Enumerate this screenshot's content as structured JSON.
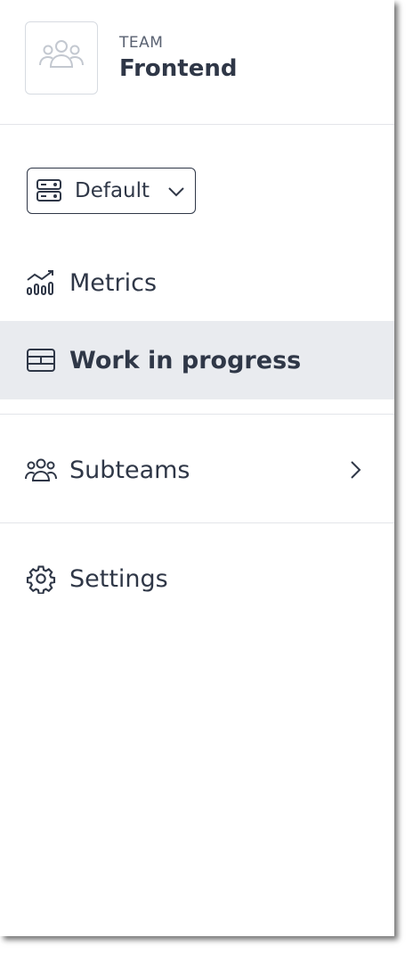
{
  "team": {
    "kicker": "TEAM",
    "name": "Frontend",
    "avatar_icon": "team-group-icon"
  },
  "view_selector": {
    "label": "Default",
    "icon": "server-stack-icon",
    "chevron": "chevron-down-icon"
  },
  "nav": {
    "metrics": {
      "label": "Metrics",
      "icon": "chart-bars-line-icon"
    },
    "wip": {
      "label": "Work in progress",
      "icon": "board-rows-icon",
      "active": true
    },
    "subteams": {
      "label": "Subteams",
      "icon": "people-group-icon",
      "chevron": "chevron-right-icon"
    },
    "settings": {
      "label": "Settings",
      "icon": "gear-icon"
    }
  },
  "colors": {
    "text": "#2f3747",
    "muted": "#5a6272",
    "active_bg": "#e9ebef",
    "divider": "#e3e5e9",
    "icon_light": "#c3c8d0"
  }
}
